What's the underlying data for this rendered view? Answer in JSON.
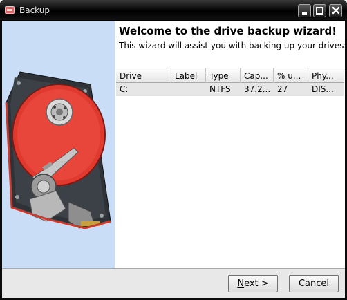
{
  "window": {
    "title": "Backup",
    "icon": "disk-utility-icon",
    "controls": [
      "minimize-icon",
      "maximize-icon",
      "close-icon"
    ]
  },
  "wizard": {
    "heading": "Welcome to the drive backup wizard!",
    "subtitle": "This wizard will assist you with backing up your drives:",
    "illustration": "hard-drive-illustration"
  },
  "drives": {
    "columns": [
      "Drive",
      "Label",
      "Type",
      "Cap...",
      "% u...",
      "Phy..."
    ],
    "rows": [
      [
        "C:",
        "",
        "NTFS",
        "37.2...",
        "27",
        "DIS..."
      ]
    ]
  },
  "buttons": {
    "next_prefix": "N",
    "next_rest": "ext >",
    "cancel": "Cancel"
  },
  "colors": {
    "titlebar": "#000000",
    "sidepanel": "#c9def6",
    "platter": "#e03a2f",
    "row_bg": "#e6e6e6"
  }
}
